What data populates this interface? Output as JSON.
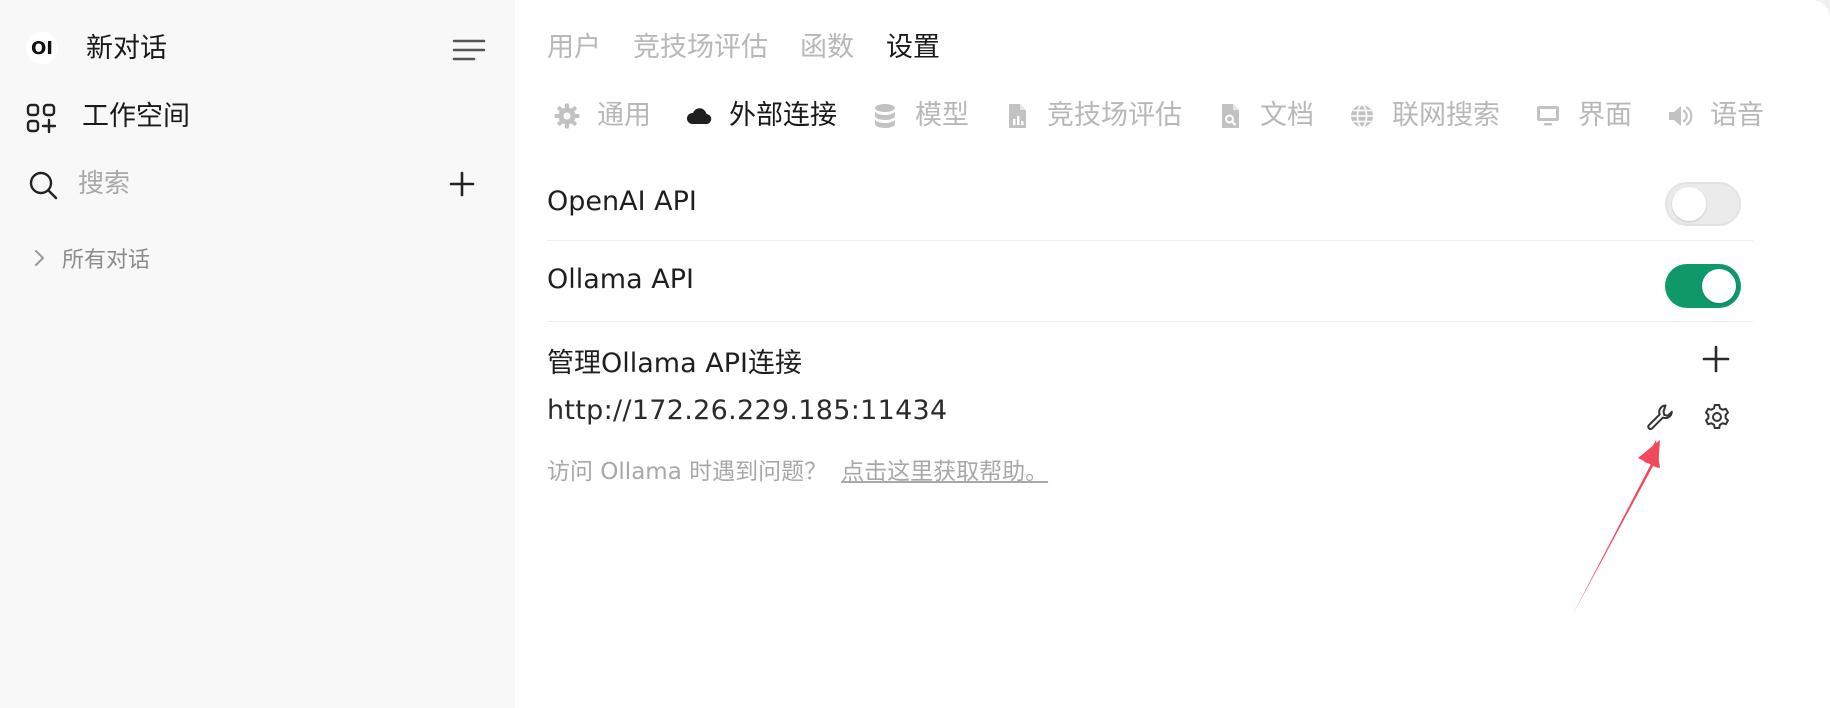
{
  "sidebar": {
    "logo_text": "OI",
    "new_chat_label": "新对话",
    "workspace_label": "工作空间",
    "search": {
      "placeholder": "搜索"
    },
    "all_chats_label": "所有对话"
  },
  "header": {
    "tabs": [
      {
        "label": "用户",
        "active": false
      },
      {
        "label": "竞技场评估",
        "active": false
      },
      {
        "label": "函数",
        "active": false
      },
      {
        "label": "设置",
        "active": true
      }
    ]
  },
  "settings": {
    "sub_tabs": [
      {
        "label": "通用",
        "icon": "gear-icon",
        "active": false
      },
      {
        "label": "外部连接",
        "icon": "cloud-icon",
        "active": true
      },
      {
        "label": "模型",
        "icon": "database-icon",
        "active": false
      },
      {
        "label": "竞技场评估",
        "icon": "document-chart-icon",
        "active": false
      },
      {
        "label": "文档",
        "icon": "document-search-icon",
        "active": false
      },
      {
        "label": "联网搜索",
        "icon": "globe-icon",
        "active": false
      },
      {
        "label": "界面",
        "icon": "monitor-icon",
        "active": false
      },
      {
        "label": "语音",
        "icon": "speaker-icon",
        "active": false
      }
    ],
    "openai_api": {
      "label": "OpenAI API",
      "enabled": false
    },
    "ollama_api": {
      "label": "Ollama API",
      "enabled": true
    },
    "manage_label": "管理Ollama API连接",
    "connection_url": "http://172.26.229.185:11434",
    "help_text": "访问 Ollama 时遇到问题？",
    "help_link": "点击这里获取帮助。"
  },
  "colors": {
    "toggle_on": "#0f9968",
    "annotation_arrow": "#f2485e"
  }
}
